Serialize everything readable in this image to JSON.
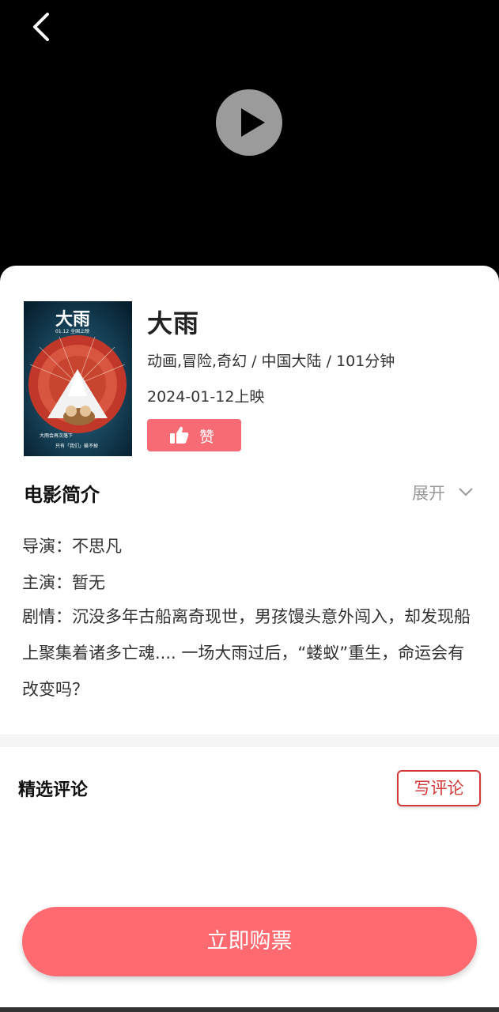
{
  "icons": {
    "back": "chevron-left-icon",
    "play": "play-icon",
    "like": "thumbs-up-icon",
    "expand": "chevron-down-icon"
  },
  "colors": {
    "accent": "#fe6a70",
    "like_button": "#f76b75",
    "write_review_border": "#d33a3a"
  },
  "movie": {
    "title": "大雨",
    "meta": "动画,冒险,奇幻 / 中国大陆 / 101分钟",
    "release": "2024-01-12上映",
    "like_label": "赞",
    "poster": {
      "title": "大雨",
      "date": "01.12 全国上映",
      "tagline_1": "大雨会再次落下",
      "tagline_2": "只有「我们」躲不掉"
    }
  },
  "intro": {
    "heading": "电影简介",
    "expand_label": "展开",
    "director": "导演：不思凡",
    "cast": "主演：暂无",
    "plot": "剧情：沉没多年古船离奇现世，男孩馒头意外闯入，却发现船上聚集着诸多亡魂.... 一场大雨过后，“蝼蚁”重生，命运会有改变吗？"
  },
  "reviews": {
    "heading": "精选评论",
    "write_label": "写评论"
  },
  "buy_label": "立即购票"
}
